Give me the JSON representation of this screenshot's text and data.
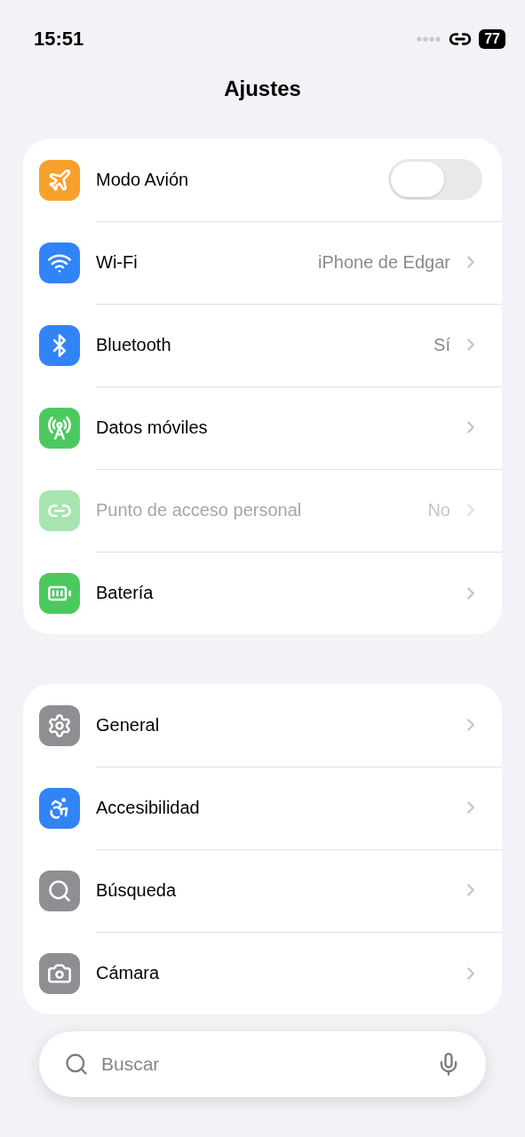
{
  "status_bar": {
    "time": "15:51",
    "battery": "77"
  },
  "title": "Ajustes",
  "groups": [
    {
      "rows": [
        {
          "kind": "toggle",
          "label": "Modo Avión",
          "on": false,
          "color": "#f7a02c",
          "disabled": false
        },
        {
          "kind": "link",
          "label": "Wi-Fi",
          "value": "iPhone de Edgar",
          "color": "#3184f6",
          "disabled": false
        },
        {
          "kind": "link",
          "label": "Bluetooth",
          "value": "Sí",
          "color": "#3184f6",
          "disabled": false
        },
        {
          "kind": "link",
          "label": "Datos móviles",
          "color": "#4cc95e",
          "disabled": false
        },
        {
          "kind": "link",
          "label": "Punto de acceso personal",
          "value": "No",
          "color": "#a6e4b0",
          "disabled": true
        },
        {
          "kind": "link",
          "label": "Batería",
          "color": "#4cc95e",
          "disabled": false
        }
      ]
    },
    {
      "rows": [
        {
          "kind": "link",
          "label": "General",
          "color": "#8e8e93",
          "disabled": false
        },
        {
          "kind": "link",
          "label": "Accesibilidad",
          "color": "#3184f6",
          "disabled": false
        },
        {
          "kind": "link",
          "label": "Búsqueda",
          "color": "#8e8e93",
          "disabled": false
        },
        {
          "kind": "link",
          "label": "Cámara",
          "color": "#8e8e93",
          "disabled": false
        }
      ]
    }
  ],
  "search": {
    "placeholder": "Buscar"
  }
}
